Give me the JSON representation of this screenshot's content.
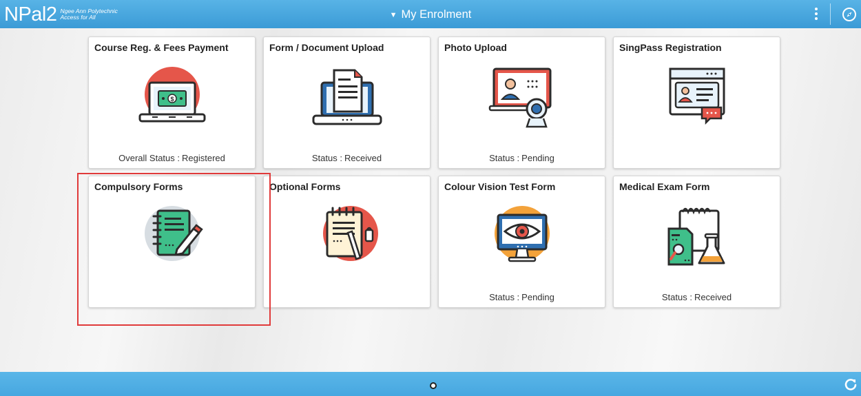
{
  "header": {
    "logo_main": "NPal2",
    "logo_sub_line1": "Ngee Ann Polytechnic",
    "logo_sub_line2": "Access for All",
    "title": "My Enrolment",
    "menu_icon": "kebab-menu-icon",
    "nav_icon": "compass-icon"
  },
  "tiles": [
    {
      "title": "Course Reg. & Fees Payment",
      "status_label": "Overall Status :",
      "status_value": "Registered",
      "icon": "laptop-payment-icon"
    },
    {
      "title": "Form / Document Upload",
      "status_label": "Status :",
      "status_value": "Received",
      "icon": "laptop-document-icon"
    },
    {
      "title": "Photo Upload",
      "status_label": "Status :",
      "status_value": "Pending",
      "icon": "photo-webcam-icon"
    },
    {
      "title": "SingPass Registration",
      "status_label": "",
      "status_value": "",
      "icon": "id-card-browser-icon"
    },
    {
      "title": "Compulsory Forms",
      "status_label": "",
      "status_value": "",
      "icon": "notebook-pencil-icon"
    },
    {
      "title": "Optional Forms",
      "status_label": "",
      "status_value": "",
      "icon": "notepad-pen-icon"
    },
    {
      "title": "Colour Vision Test Form",
      "status_label": "Status :",
      "status_value": "Pending",
      "icon": "monitor-eye-icon"
    },
    {
      "title": "Medical Exam Form",
      "status_label": "Status :",
      "status_value": "Received",
      "icon": "lab-report-icon"
    }
  ],
  "footer": {
    "page_indicator_icon": "page-dot-icon",
    "refresh_icon": "refresh-icon"
  },
  "colors": {
    "header_blue": "#3b9bd6",
    "footer_blue": "#4aa9e1",
    "highlight_red": "#e03a3a",
    "icon_red": "#e5564a",
    "icon_blue": "#2f6fb0",
    "icon_green": "#3fbf8a",
    "icon_orange": "#f3a23a"
  }
}
